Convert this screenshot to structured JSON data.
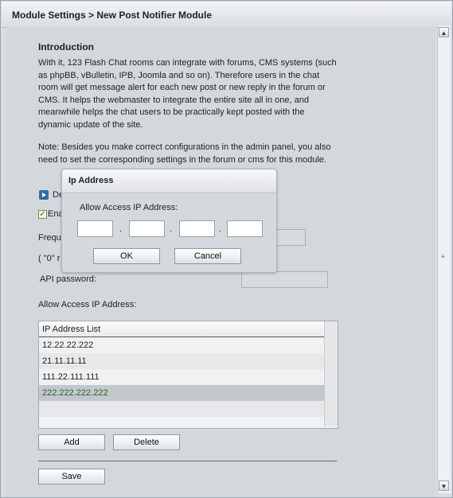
{
  "header": {
    "title": "Module Settings   > New Post Notifier Module"
  },
  "intro": {
    "heading": "Introduction",
    "lines": [
      "With it, 123 Flash Chat rooms can integrate with forums, CMS systems (such",
      "as phpBB, vBulletin, IPB, Joomla and so on). Therefore users in the chat",
      "room will get message alert for each new post or new reply in the forum or",
      "CMS. It helps the webmaster to integrate the entire site all in one, and",
      "meanwhile helps the chat users to be practically kept posted with the",
      "dynamic update of the site."
    ],
    "note_lines": [
      "Note: Besides you make correct configurations in the admin panel, you also",
      "need to set the corresponding settings in the forum or cms for this module."
    ]
  },
  "settings": {
    "download_partial": "De",
    "enable_partial": "Ena",
    "frequency_partial": "Freque",
    "zero_note_partial": "( \"0\" r",
    "api_password_label": "API password:",
    "allow_ip_label": "Allow Access IP Address:"
  },
  "ip_list": {
    "header": "IP Address List",
    "items": [
      "12.22.22.222",
      "21.11.11.11",
      "111.22.111.111",
      "222.222.222.222"
    ],
    "selected_index": 3
  },
  "buttons": {
    "add": "Add",
    "delete": "Delete",
    "save": "Save"
  },
  "dialog": {
    "title": "Ip Address",
    "label": "Allow Access IP Address:",
    "octet_separator": ".",
    "ok": "OK",
    "cancel": "Cancel"
  },
  "scrollbar": {
    "up": "▲",
    "down": "▼",
    "grip": "≡"
  },
  "colors": {
    "selected_row": "#c3c8cc",
    "selected_text": "#2f5f28"
  }
}
